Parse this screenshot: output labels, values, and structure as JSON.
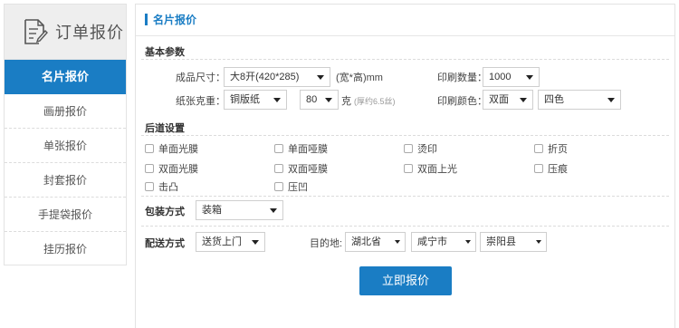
{
  "sidebar": {
    "title": "订单报价",
    "header_icon": "document-edit-icon",
    "items": [
      {
        "label": "名片报价",
        "active": true
      },
      {
        "label": "画册报价",
        "active": false
      },
      {
        "label": "单张报价",
        "active": false
      },
      {
        "label": "封套报价",
        "active": false
      },
      {
        "label": "手提袋报价",
        "active": false
      },
      {
        "label": "挂历报价",
        "active": false
      }
    ]
  },
  "main": {
    "title": "名片报价",
    "basic": {
      "heading": "基本参数",
      "size": {
        "label": "成品尺寸：",
        "value": "大8开(420*285)",
        "unit": "(宽*高)mm"
      },
      "quantity": {
        "label": "印刷数量：",
        "value": "1000"
      },
      "paper": {
        "label": "纸张克重：",
        "type": "铜版纸",
        "weight": "80",
        "unit": "克",
        "hint": "(厚约6.5丝)"
      },
      "print_color": {
        "label": "印刷颜色：",
        "sides": "双面",
        "colors": "四色"
      }
    },
    "post": {
      "heading": "后道设置",
      "options": [
        "单面光膜",
        "单面哑膜",
        "烫印",
        "折页",
        "双面光膜",
        "双面哑膜",
        "双面上光",
        "压痕",
        "击凸",
        "压凹"
      ]
    },
    "packaging": {
      "label": "包装方式",
      "value": "装箱"
    },
    "delivery": {
      "label": "配送方式",
      "method": "送货上门",
      "dest_label": "目的地:",
      "province": "湖北省",
      "city": "咸宁市",
      "county": "崇阳县"
    },
    "submit_label": "立即报价"
  },
  "colors": {
    "accent": "#1a7dc4",
    "sidebar_header_bg": "#eeeeee"
  }
}
